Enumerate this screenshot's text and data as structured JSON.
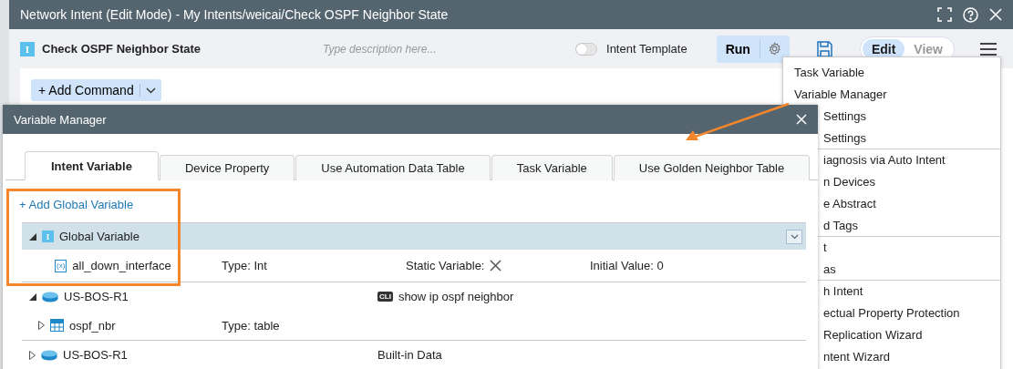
{
  "window": {
    "title": "Network Intent (Edit Mode) - My Intents/weicai/Check OSPF Neighbor State"
  },
  "toolbar": {
    "intent_icon": "I",
    "intent_name": "Check OSPF Neighbor State",
    "description_placeholder": "Type description here...",
    "intent_template": {
      "label": "Intent Template",
      "on": false
    },
    "run_label": "Run",
    "modes": [
      {
        "label": "Edit",
        "selected": true
      },
      {
        "label": "View",
        "selected": false
      }
    ]
  },
  "add_command": {
    "label": "+ Add Command"
  },
  "menu": {
    "items": [
      {
        "label": "Task Variable",
        "divider_after": false
      },
      {
        "label": "Variable Manager",
        "divider_after": false
      },
      {
        "label": "Settings",
        "divider_after": false
      },
      {
        "label": "Settings",
        "divider_after": true
      },
      {
        "label": "iagnosis via Auto Intent",
        "divider_after": false
      },
      {
        "label": "n Devices",
        "divider_after": false
      },
      {
        "label": "e Abstract",
        "divider_after": false
      },
      {
        "label": "d Tags",
        "divider_after": true
      },
      {
        "label": "t",
        "divider_after": false
      },
      {
        "label": "as",
        "divider_after": true
      },
      {
        "label": "h Intent",
        "divider_after": false
      },
      {
        "label": "ectual Property Protection",
        "divider_after": false
      },
      {
        "label": "Replication Wizard",
        "divider_after": false
      },
      {
        "label": "ntent Wizard",
        "divider_after": false
      }
    ]
  },
  "dialog": {
    "title": "Variable Manager",
    "tabs": [
      {
        "label": "Intent Variable",
        "selected": true
      },
      {
        "label": "Device Property",
        "selected": false
      },
      {
        "label": "Use Automation Data Table",
        "selected": false
      },
      {
        "label": "Task Variable",
        "selected": false
      },
      {
        "label": "Use Golden Neighbor Table",
        "selected": false
      }
    ],
    "add_link": "+ Add Global Variable",
    "groups": [
      {
        "kind": "global",
        "icon": "I",
        "label": "Global Variable",
        "expanded": true,
        "selected": true,
        "children": [
          {
            "kind": "variable",
            "icon": "(x)",
            "name": "all_down_interface",
            "type": "Type: Int",
            "static_label": "Static Variable:",
            "static": false,
            "initial": "Initial Value: 0"
          }
        ]
      },
      {
        "kind": "device",
        "label": "US-BOS-R1",
        "expanded": true,
        "selected": false,
        "detail_badge": "CLI",
        "detail": "show ip ospf neighbor",
        "children": [
          {
            "kind": "table",
            "name": "ospf_nbr",
            "type": "Type: table",
            "expanded": false
          }
        ]
      },
      {
        "kind": "device",
        "label": "US-BOS-R1",
        "expanded": false,
        "selected": false,
        "detail": "Built-in Data"
      }
    ]
  }
}
